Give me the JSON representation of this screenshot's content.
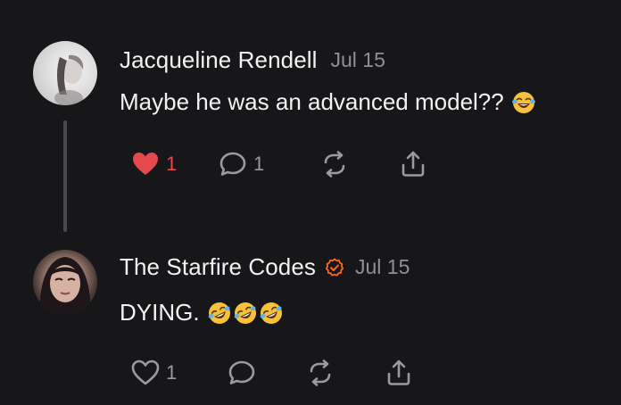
{
  "comments": [
    {
      "author": "Jacqueline Rendell",
      "date": "Jul 15",
      "text": "Maybe he was an advanced model??",
      "verified": false,
      "emoji": [
        "face-with-tears-of-joy"
      ],
      "likes": "1",
      "liked": true,
      "replies": "1",
      "like_color": "#e5484d"
    },
    {
      "author": "The Starfire Codes",
      "date": "Jul 15",
      "text": "DYING.",
      "verified": true,
      "verified_color": "#ff6719",
      "emoji": [
        "rolling-on-floor-laughing",
        "rolling-on-floor-laughing",
        "rolling-on-floor-laughing"
      ],
      "likes": "1",
      "liked": false,
      "replies": ""
    }
  ],
  "icons": {
    "like": "heart-icon",
    "reply": "speech-bubble-icon",
    "restack": "restack-arrows-icon",
    "share": "share-upload-icon"
  }
}
